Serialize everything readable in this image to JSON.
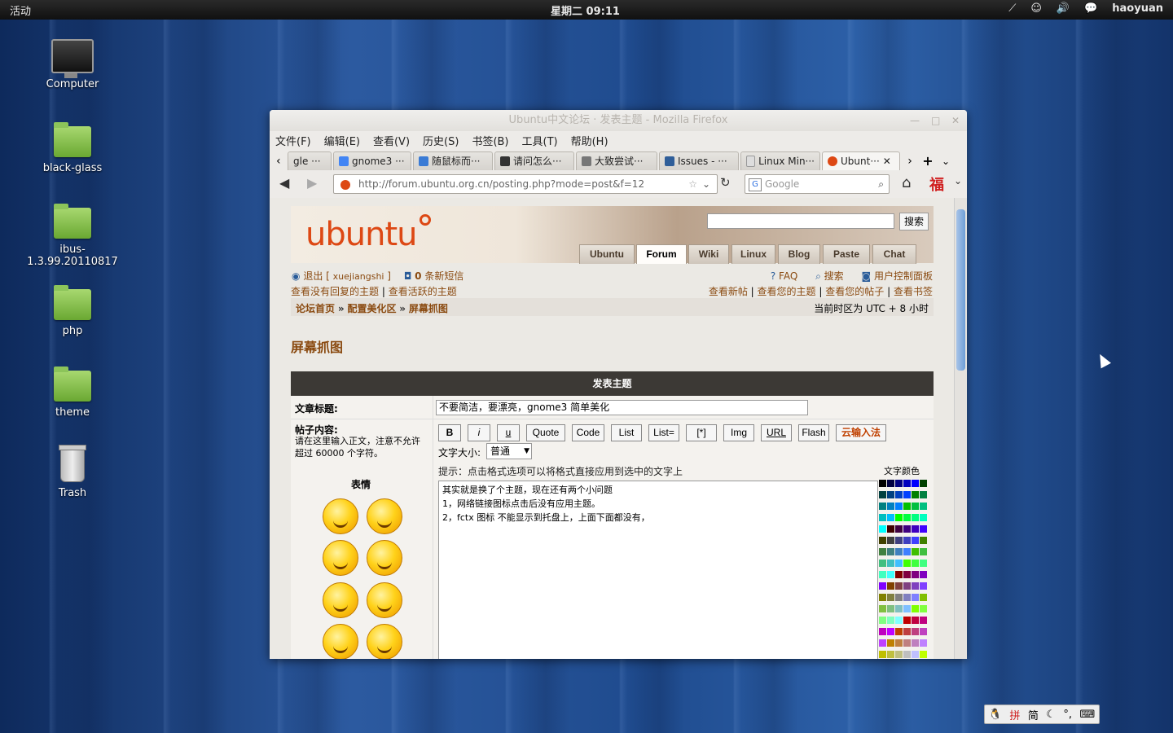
{
  "topbar": {
    "activities": "活动",
    "clock": "星期二 09:11",
    "user": "haoyuan"
  },
  "desktop": {
    "icons": [
      "Computer",
      "black-glass",
      "ibus-1.3.99.20110817",
      "php",
      "theme",
      "Trash"
    ]
  },
  "window": {
    "title": "Ubuntu中文论坛 · 发表主题 - Mozilla Firefox",
    "menu": [
      "文件(F)",
      "编辑(E)",
      "查看(V)",
      "历史(S)",
      "书签(B)",
      "工具(T)",
      "帮助(H)"
    ],
    "tabs": [
      "gle ···",
      "gnome3 ···",
      "随鼠标而···",
      "请问怎么···",
      "大致尝试···",
      "Issues - ···",
      "Linux Min···",
      "Ubunt···"
    ],
    "url": "http://forum.ubuntu.org.cn/posting.php?mode=post&f=12",
    "search_placeholder": "Google"
  },
  "forum": {
    "logo": "ubuntu",
    "search_button": "搜索",
    "nav_tabs": [
      "Ubuntu",
      "Forum",
      "Wiki",
      "Linux",
      "Blog",
      "Paste",
      "Chat"
    ],
    "logout": "退出",
    "username": "xuejiangshi",
    "msg_count": "0",
    "msg_label": "条新短信",
    "faq": "FAQ",
    "search": "搜索",
    "ucp": "用户控制面板",
    "left_links": [
      "查看没有回复的主题",
      "查看活跃的主题"
    ],
    "right_links": [
      "查看新帖",
      "查看您的主题",
      "查看您的帖子",
      "查看书签"
    ],
    "breadcrumb": [
      "论坛首页",
      "配置美化区",
      "屏幕抓图"
    ],
    "timezone": "当前时区为 UTC + 8 小时",
    "page_title": "屏幕抓图",
    "post_header": "发表主题",
    "subject_label": "文章标题:",
    "subject_value": "不要简洁，要漂亮，gnome3 简单美化",
    "content_label": "帖子内容:",
    "content_hint": "请在这里输入正文，注意不允许超过 60000 个字符。",
    "smilies_label": "表情",
    "format_buttons": [
      "B",
      "i",
      "u",
      "Quote",
      "Code",
      "List",
      "List=",
      "[*]",
      "Img",
      "URL",
      "Flash",
      "云输入法"
    ],
    "font_size_label": "文字大小:",
    "font_size_value": "普通",
    "tip": "提示：点击格式选项可以将格式直接应用到选中的文字上",
    "color_label": "文字颜色",
    "body_lines": [
      "其实就是换了个主题，现在还有两个小问题",
      "1，网络链接图标点击后没有应用主题。",
      "2，fctx 图标 不能显示到托盘上，上面下面都没有，"
    ]
  },
  "ime": {
    "mode": "简"
  }
}
